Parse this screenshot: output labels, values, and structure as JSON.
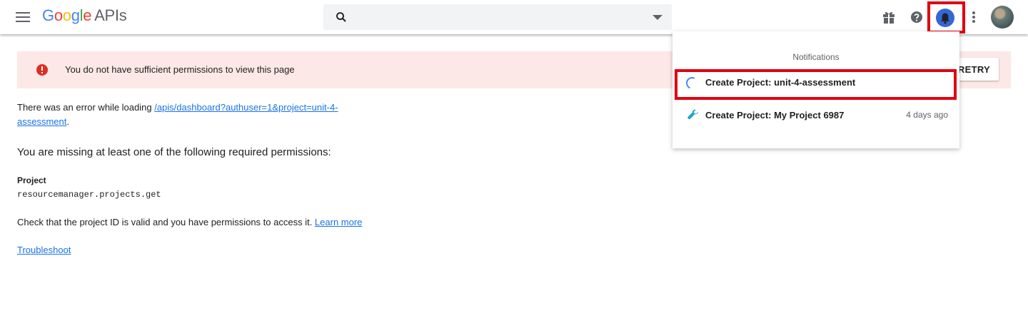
{
  "header": {
    "logo": [
      "G",
      "o",
      "o",
      "g",
      "l",
      "e"
    ],
    "logo_suffix": "APIs",
    "search": {
      "value": "",
      "placeholder": ""
    }
  },
  "banner": {
    "message": "You do not have sufficient permissions to view this page",
    "retry_label": "RETRY"
  },
  "content": {
    "error_prefix": "There was an error while loading ",
    "error_link": "/apis/dashboard?authuser=1&project=unit-4-assessment",
    "error_suffix": ".",
    "missing": "You are missing at least one of the following required permissions:",
    "project_label": "Project",
    "permission": "resourcemanager.projects.get",
    "check_text": "Check that the project ID is valid and you have permissions to access it. ",
    "learn_more": "Learn more",
    "troubleshoot": "Troubleshoot"
  },
  "notifications": {
    "title": "Notifications",
    "items": [
      {
        "name": "Create Project: unit-4-assessment",
        "time": "",
        "icon": "spinner-icon"
      },
      {
        "name": "Create Project: My Project 6987",
        "time": "4 days ago",
        "icon": "wrench-icon"
      }
    ]
  },
  "colors": {
    "accent": "#1a73e8",
    "error": "#d93025",
    "banner_bg": "#fce8e6",
    "highlight": "#e0000f",
    "bell_bg": "#3367d6"
  }
}
